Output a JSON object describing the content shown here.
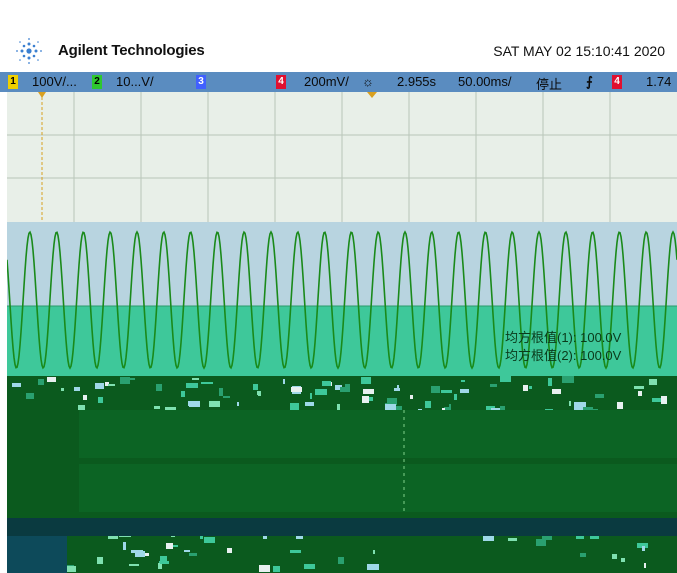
{
  "header": {
    "brand": "Agilent Technologies",
    "datetime": "SAT MAY 02 15:10:41 2020",
    "logo_icon": "agilent-spark-icon"
  },
  "statusbar": {
    "ch1_num": "1",
    "ch1_scale": "100V/...",
    "ch2_num": "2",
    "ch2_scale": "10...V/",
    "ch3_num": "3",
    "ch4_num": "4",
    "ch4_scale": "200mV/",
    "time_delay": "2.955s",
    "time_scale": "50.00ms/",
    "run_state": "停止",
    "trigger_channel": "4",
    "trigger_level": "1.74"
  },
  "measurements": {
    "rms1": "均方根值(1): 100.0V",
    "rms2": "均方根值(2): 100.0V"
  },
  "colors": {
    "grid_bg": "#e8efe8",
    "trace_green": "#1a8a1a",
    "band_blue": "#b8d4e0",
    "band_teal": "#3ec89a",
    "lower_green": "#0b5a1e",
    "status_blue": "#5a8cc0",
    "ch1_yellow": "#f0d000",
    "ch2_green": "#2ec82e",
    "ch3_blue": "#4060ff",
    "ch4_red": "#e01030"
  }
}
